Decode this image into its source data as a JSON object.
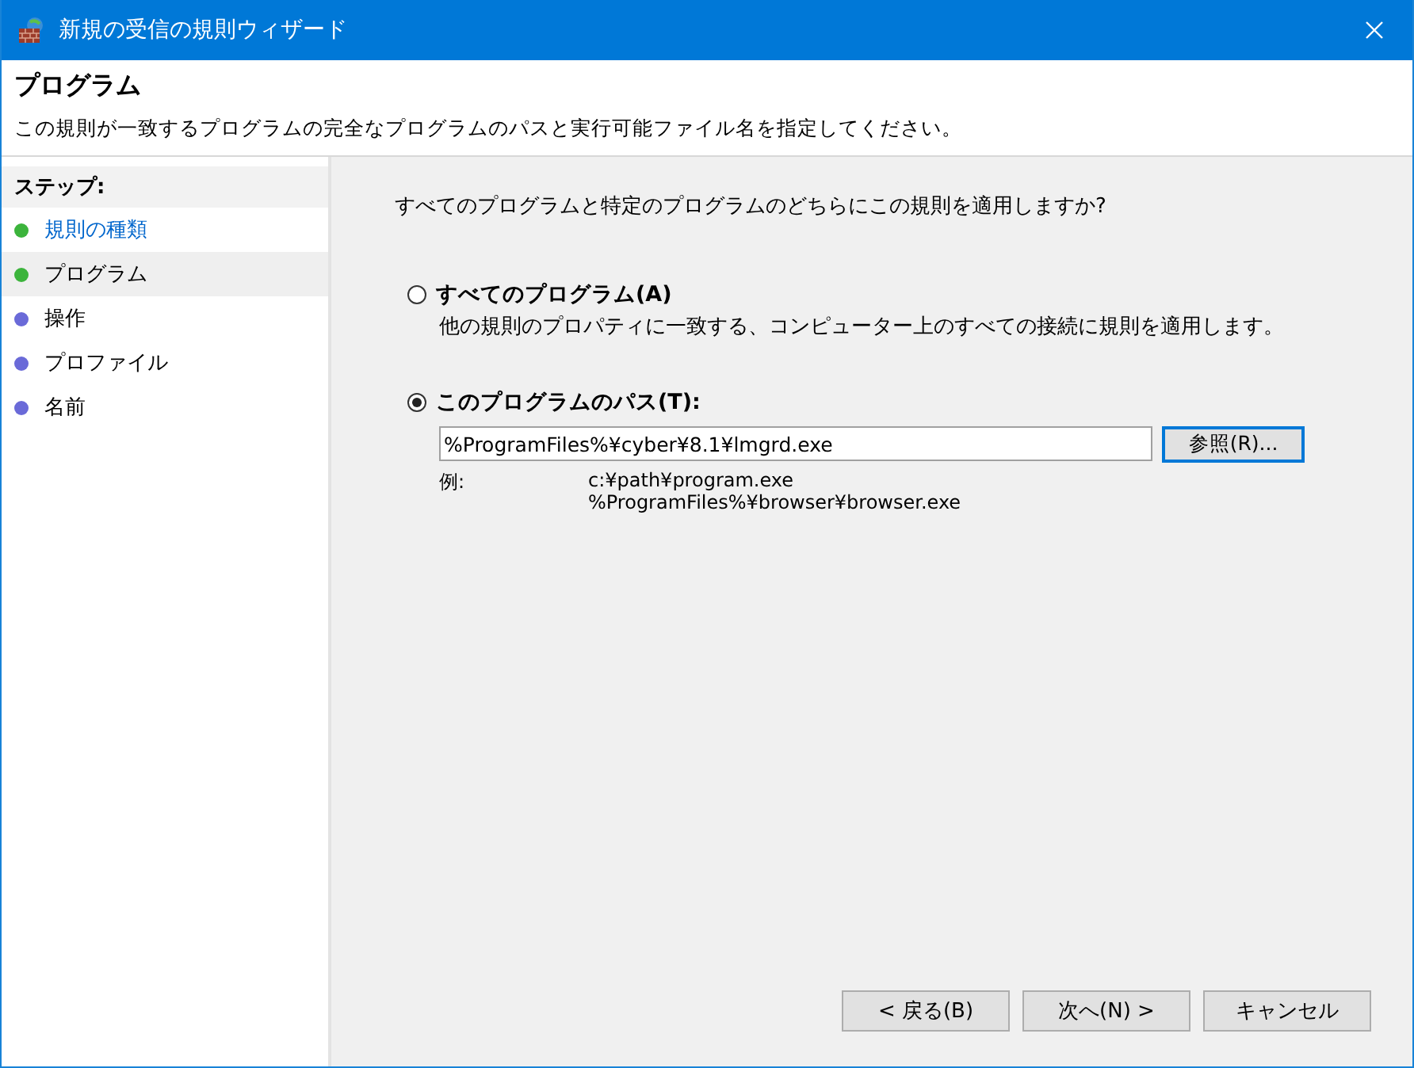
{
  "window": {
    "title": "新規の受信の規則ウィザード"
  },
  "header": {
    "title": "プログラム",
    "description": "この規則が一致するプログラムの完全なプログラムのパスと実行可能ファイル名を指定してください。"
  },
  "sidebar": {
    "heading": "ステップ:",
    "items": [
      {
        "label": "規則の種類",
        "completed": true,
        "link": true,
        "selected": false
      },
      {
        "label": "プログラム",
        "completed": true,
        "link": false,
        "selected": true
      },
      {
        "label": "操作",
        "completed": false,
        "link": false,
        "selected": false
      },
      {
        "label": "プロファイル",
        "completed": false,
        "link": false,
        "selected": false
      },
      {
        "label": "名前",
        "completed": false,
        "link": false,
        "selected": false
      }
    ]
  },
  "question": "すべてのプログラムと特定のプログラムのどちらにこの規則を適用しますか?",
  "options": [
    {
      "label": "すべてのプログラム(A)",
      "description": "他の規則のプロパティに一致する、コンピューター上のすべての接続に規則を適用します。",
      "selected": false
    },
    {
      "label": "このプログラムのパス(T):",
      "selected": true
    }
  ],
  "path_field": {
    "value": "%ProgramFiles%¥cyber¥8.1¥lmgrd.exe"
  },
  "browse_button": "参照(R)...",
  "example": {
    "label": "例:",
    "lines": [
      "c:¥path¥program.exe",
      "%ProgramFiles%¥browser¥browser.exe"
    ]
  },
  "buttons": [
    "< 戻る(B)",
    "次へ(N) >",
    "キャンセル"
  ]
}
